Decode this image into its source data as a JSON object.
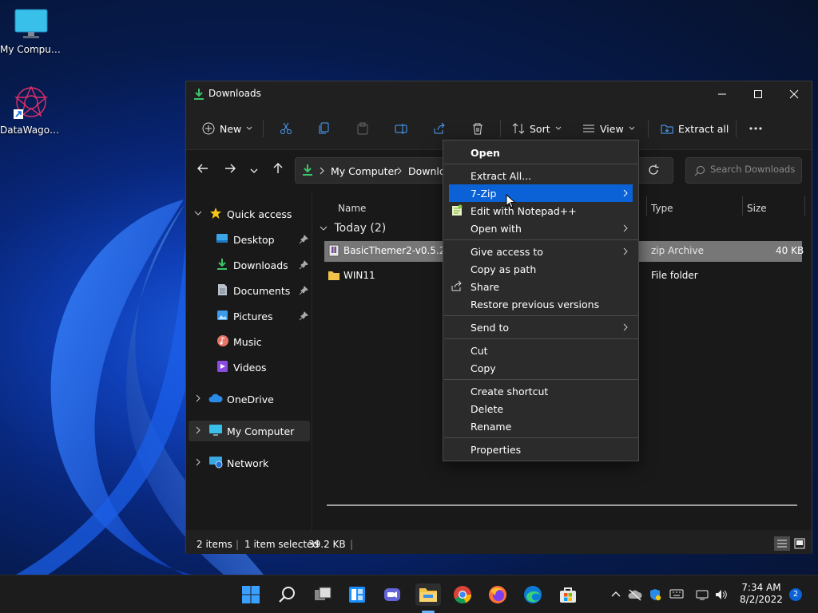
{
  "desktop": {
    "icons": [
      {
        "label": "My Computer"
      },
      {
        "label": "DataWagon..."
      }
    ]
  },
  "window": {
    "title": "Downloads",
    "controls": {
      "minimize": "minimize",
      "maximize": "maximize",
      "close": "close"
    }
  },
  "toolbar": {
    "new_label": "New",
    "sort_label": "Sort",
    "view_label": "View",
    "extract_label": "Extract all"
  },
  "address": {
    "crumbs": [
      "My Computer",
      "Downloads"
    ],
    "search_placeholder": "Search Downloads"
  },
  "nav": {
    "quick_access": "Quick access",
    "items": [
      {
        "label": "Desktop",
        "pinned": true
      },
      {
        "label": "Downloads",
        "pinned": true
      },
      {
        "label": "Documents",
        "pinned": true
      },
      {
        "label": "Pictures",
        "pinned": true
      },
      {
        "label": "Music",
        "pinned": false
      },
      {
        "label": "Videos",
        "pinned": false
      }
    ],
    "onedrive": "OneDrive",
    "my_computer": "My Computer",
    "network": "Network"
  },
  "file_list": {
    "columns": [
      "Name",
      "Type",
      "Size"
    ],
    "group": "Today (2)",
    "rows": [
      {
        "name": "BasicThemer2-v0.5.2-Re",
        "type": "zip Archive",
        "size": "40 KB",
        "selected": true
      },
      {
        "name": "WIN11",
        "type": "File folder",
        "size": "",
        "selected": false
      }
    ]
  },
  "status": {
    "items": "2 items",
    "selected": "1 item selected",
    "size": "39.2 KB"
  },
  "context_menu": {
    "items": {
      "open": "Open",
      "extract_all": "Extract All...",
      "seven_zip": "7-Zip",
      "notepad": "Edit with Notepad++",
      "open_with": "Open with",
      "give_access": "Give access to",
      "copy_path": "Copy as path",
      "share": "Share",
      "restore": "Restore previous versions",
      "send_to": "Send to",
      "cut": "Cut",
      "copy": "Copy",
      "create_shortcut": "Create shortcut",
      "delete": "Delete",
      "rename": "Rename",
      "properties": "Properties"
    },
    "highlight_color": "#0a62d6"
  },
  "taskbar": {
    "time": "7:34 AM",
    "date": "8/2/2022",
    "notifications": "2"
  }
}
